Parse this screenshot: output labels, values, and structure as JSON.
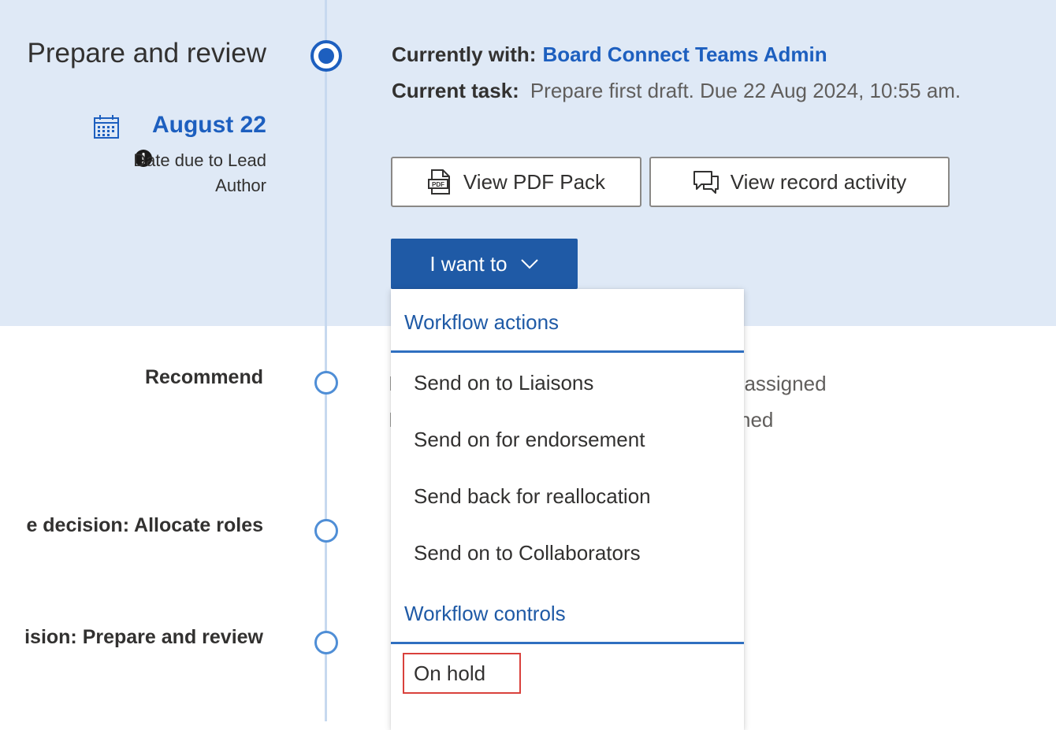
{
  "stage": {
    "title": "Prepare and review",
    "due_date": "August 22",
    "due_note": "Date due to Lead Author",
    "currently_with_label": "Currently with:",
    "currently_with_value": "Board Connect Teams Admin",
    "current_task_label": "Current task:",
    "current_task_value": "Prepare first draft. Due 22 Aug 2024, 10:55 am."
  },
  "buttons": {
    "view_pdf": "View PDF Pack",
    "view_activity": "View record activity",
    "i_want_to": "I want to"
  },
  "steps": [
    {
      "label": "Recommend"
    },
    {
      "label": "e decision: Allocate roles"
    },
    {
      "label": "ision: Prepare and review"
    }
  ],
  "background_text": {
    "line1_left": "I",
    "line1_right": "t assigned",
    "line2_left": "I",
    "line2_right": "ned"
  },
  "menu": {
    "section1_header": "Workflow actions",
    "section1_items": [
      "Send on to Liaisons",
      "Send on for endorsement",
      "Send back for reallocation",
      "Send on to Collaborators"
    ],
    "section2_header": "Workflow controls",
    "section2_items": [
      "On hold"
    ]
  },
  "icons": {
    "calendar": "calendar-icon",
    "alert": "exclamation-circle-icon",
    "pdf": "pdf-file-icon",
    "activity": "chat-bubbles-icon",
    "chevron": "chevron-down-icon"
  },
  "colors": {
    "accent": "#1d5fbf",
    "primary_button": "#1f5aa6",
    "stage_band": "#dfe9f6",
    "highlight_box": "#d9413c"
  }
}
